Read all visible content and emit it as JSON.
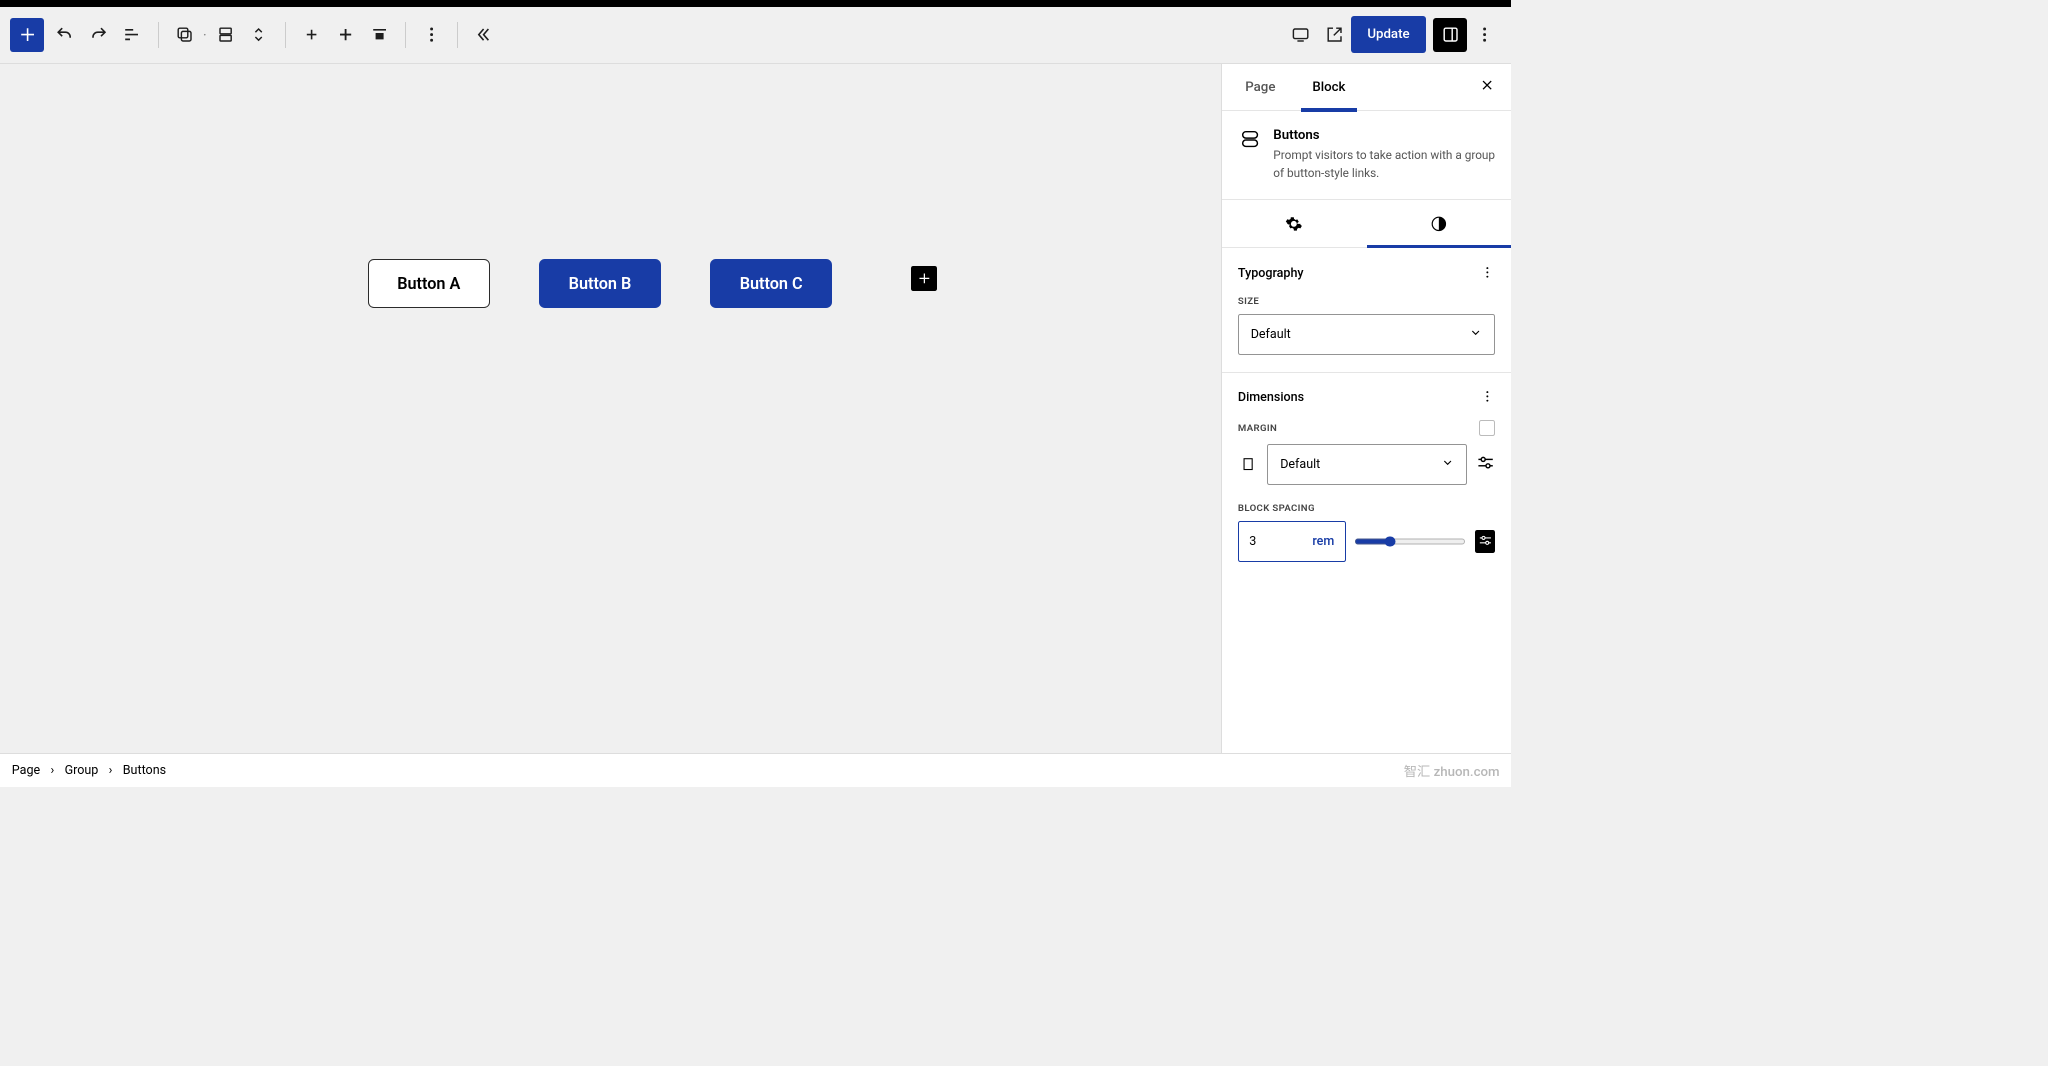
{
  "toolbar": {
    "update_label": "Update"
  },
  "canvas": {
    "button_a": "Button A",
    "button_b": "Button B",
    "button_c": "Button C"
  },
  "sidebar": {
    "tab_page": "Page",
    "tab_block": "Block",
    "block_name": "Buttons",
    "block_desc": "Prompt visitors to take action with a group of button-style links.",
    "typography": {
      "title": "Typography",
      "size_label": "Size",
      "size_value": "Default"
    },
    "dimensions": {
      "title": "Dimensions",
      "margin_label": "Margin",
      "margin_value": "Default",
      "spacing_label": "Block Spacing",
      "spacing_value": "3",
      "spacing_unit": "rem"
    }
  },
  "breadcrumb": {
    "page": "Page",
    "group": "Group",
    "buttons": "Buttons"
  },
  "watermark": "智汇 zhuon.com"
}
